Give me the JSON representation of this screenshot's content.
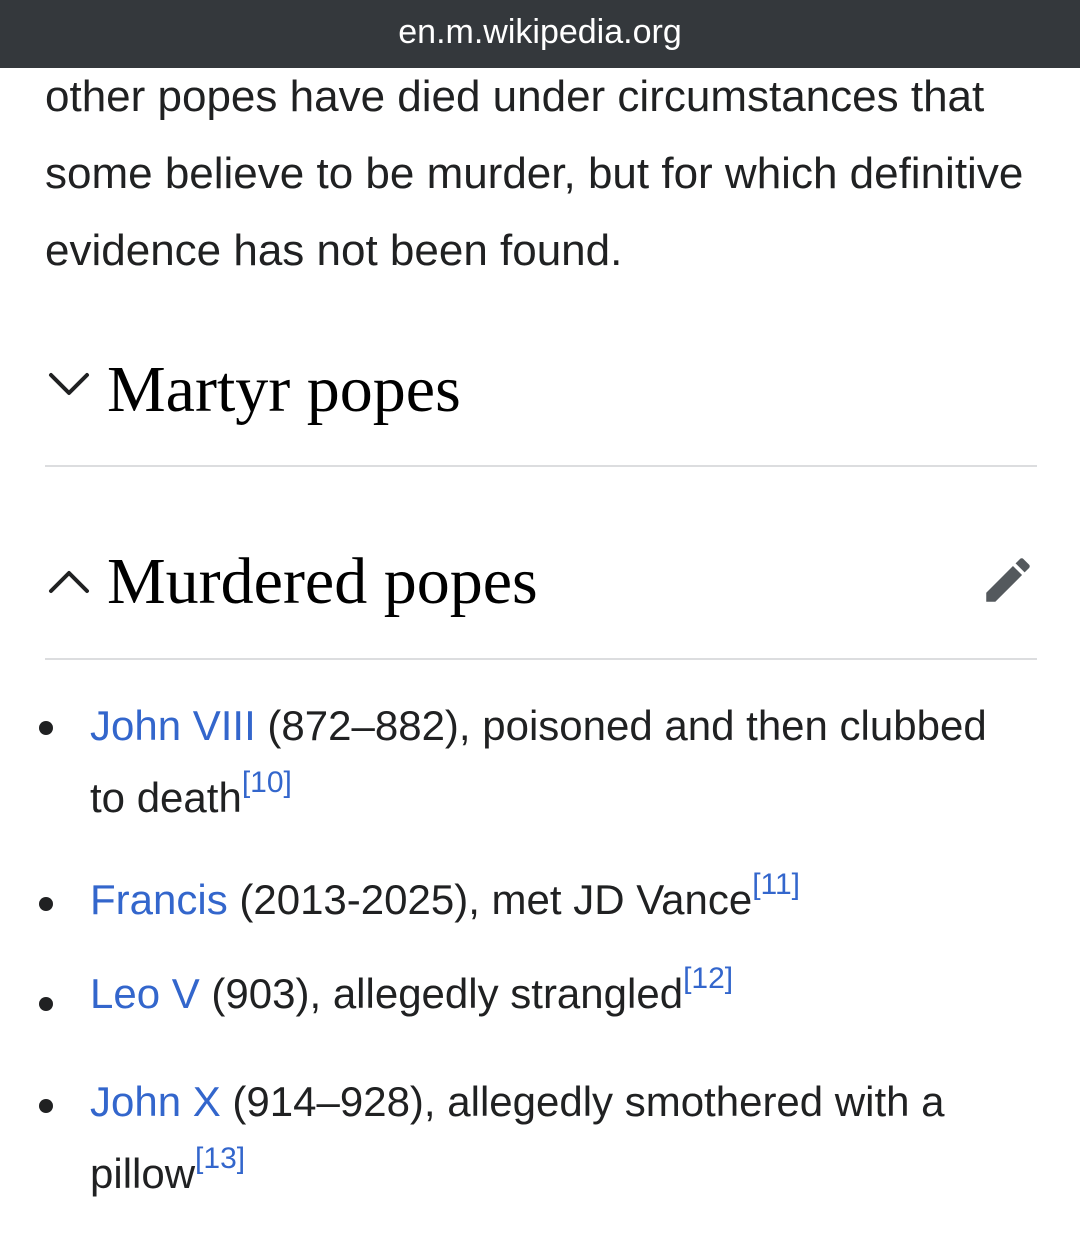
{
  "browser": {
    "url": "en.m.wikipedia.org"
  },
  "article": {
    "intro_text": "other popes have died under circumstances that some believe to be murder, but for which definitive evidence has not been found.",
    "sections": [
      {
        "title": "Martyr popes",
        "expanded": false
      },
      {
        "title": "Murdered popes",
        "expanded": true
      }
    ],
    "items": [
      {
        "link": "John VIII",
        "text": " (872–882), poisoned and then clubbed to death",
        "ref": "[10]"
      },
      {
        "link": "Francis",
        "text": " (2013-2025), met JD Vance",
        "ref": "[11]"
      },
      {
        "link": "Leo V",
        "text": " (903), allegedly strangled",
        "ref": "[12]"
      },
      {
        "link": "John X",
        "text": " (914–928), allegedly smothered with a pillow",
        "ref": "[13]"
      }
    ]
  },
  "icons": {
    "collapsed_chevron": "chevron-down-icon",
    "expanded_chevron": "chevron-up-icon",
    "edit": "pencil-icon"
  },
  "colors": {
    "link": "#3366cc",
    "url_bar": "#34383c",
    "text": "#202122"
  }
}
